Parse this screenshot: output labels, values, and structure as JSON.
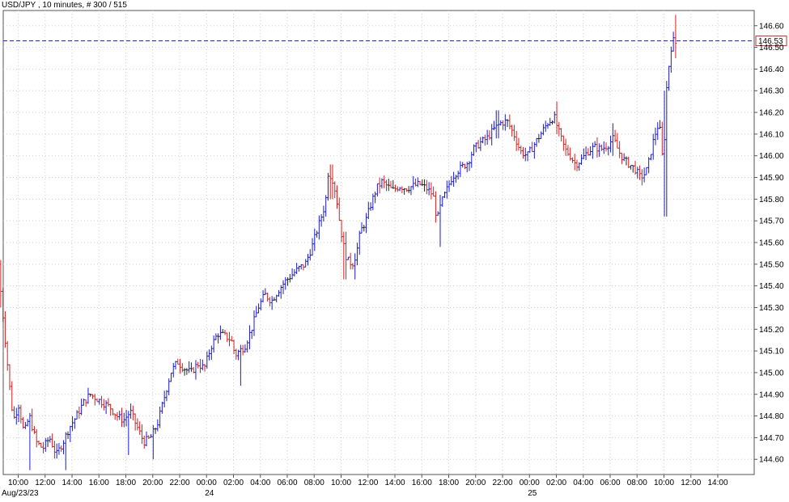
{
  "header": {
    "symbol": "USD/JPY",
    "timeframe": "10 minutes",
    "bar_count": "# 300 / 515"
  },
  "colors": {
    "up": "#1a1ad6",
    "down": "#d42020",
    "neutral": "#222222",
    "grid": "#cfcfcf",
    "current_price_line": "#2222cc"
  },
  "chart_data": {
    "type": "ohlc",
    "instrument": "USD/JPY",
    "interval": "10 minutes",
    "ylim": [
      144.53,
      146.67
    ],
    "y_ticks": [
      "146.60",
      "146.50",
      "146.40",
      "146.30",
      "146.20",
      "146.10",
      "146.00",
      "145.90",
      "145.80",
      "145.70",
      "145.60",
      "145.50",
      "145.40",
      "145.30",
      "145.20",
      "145.10",
      "145.00",
      "144.90",
      "144.80",
      "144.70",
      "144.60"
    ],
    "x_ticks": [
      {
        "label": "10:00",
        "hour": 10
      },
      {
        "label": "12:00",
        "hour": 12
      },
      {
        "label": "14:00",
        "hour": 14
      },
      {
        "label": "16:00",
        "hour": 16
      },
      {
        "label": "18:00",
        "hour": 18
      },
      {
        "label": "20:00",
        "hour": 20
      },
      {
        "label": "22:00",
        "hour": 22
      },
      {
        "label": "00:00",
        "hour": 24
      },
      {
        "label": "02:00",
        "hour": 26
      },
      {
        "label": "04:00",
        "hour": 28
      },
      {
        "label": "06:00",
        "hour": 30
      },
      {
        "label": "08:00",
        "hour": 32
      },
      {
        "label": "10:00",
        "hour": 34
      },
      {
        "label": "12:00",
        "hour": 36
      },
      {
        "label": "14:00",
        "hour": 38
      },
      {
        "label": "16:00",
        "hour": 40
      },
      {
        "label": "18:00",
        "hour": 42
      },
      {
        "label": "20:00",
        "hour": 44
      },
      {
        "label": "22:00",
        "hour": 46
      },
      {
        "label": "00:00",
        "hour": 48
      },
      {
        "label": "02:00",
        "hour": 50
      },
      {
        "label": "04:00",
        "hour": 52
      },
      {
        "label": "06:00",
        "hour": 54
      },
      {
        "label": "08:00",
        "hour": 56
      },
      {
        "label": "10:00",
        "hour": 58
      },
      {
        "label": "12:00",
        "hour": 60
      },
      {
        "label": "14:00",
        "hour": 62
      }
    ],
    "date_labels": [
      {
        "label": "Aug/23/23",
        "hour": 8.6
      },
      {
        "label": "24",
        "hour": 24
      },
      {
        "label": "25",
        "hour": 48
      }
    ],
    "current_price": 146.53,
    "current_price_label": "146.53",
    "price_path": [
      [
        8.7,
        145.5
      ],
      [
        8.9,
        145.35
      ],
      [
        9.2,
        145.15
      ],
      [
        9.5,
        144.95
      ],
      [
        9.8,
        144.78
      ],
      [
        10.2,
        144.85
      ],
      [
        10.6,
        144.72
      ],
      [
        11.0,
        144.8
      ],
      [
        11.5,
        144.68
      ],
      [
        12.0,
        144.65
      ],
      [
        12.5,
        144.7
      ],
      [
        13.0,
        144.62
      ],
      [
        13.5,
        144.68
      ],
      [
        14.0,
        144.75
      ],
      [
        14.5,
        144.8
      ],
      [
        15.0,
        144.86
      ],
      [
        15.5,
        144.9
      ],
      [
        16.0,
        144.88
      ],
      [
        16.5,
        144.86
      ],
      [
        17.0,
        144.84
      ],
      [
        17.5,
        144.8
      ],
      [
        18.0,
        144.78
      ],
      [
        18.5,
        144.82
      ],
      [
        19.0,
        144.75
      ],
      [
        19.5,
        144.68
      ],
      [
        20.0,
        144.7
      ],
      [
        20.5,
        144.76
      ],
      [
        21.0,
        144.88
      ],
      [
        21.5,
        145.0
      ],
      [
        22.0,
        145.05
      ],
      [
        22.5,
        145.02
      ],
      [
        23.0,
        145.0
      ],
      [
        23.5,
        145.04
      ],
      [
        24.0,
        145.02
      ],
      [
        24.5,
        145.12
      ],
      [
        25.0,
        145.18
      ],
      [
        25.5,
        145.17
      ],
      [
        26.0,
        145.15
      ],
      [
        26.3,
        145.08
      ],
      [
        26.6,
        145.1
      ],
      [
        27.0,
        145.12
      ],
      [
        27.5,
        145.2
      ],
      [
        28.0,
        145.3
      ],
      [
        28.5,
        145.36
      ],
      [
        29.0,
        145.33
      ],
      [
        29.5,
        145.38
      ],
      [
        30.0,
        145.42
      ],
      [
        30.5,
        145.45
      ],
      [
        31.0,
        145.48
      ],
      [
        31.5,
        145.5
      ],
      [
        32.0,
        145.58
      ],
      [
        32.5,
        145.68
      ],
      [
        33.0,
        145.78
      ],
      [
        33.2,
        145.92
      ],
      [
        33.5,
        145.9
      ],
      [
        33.8,
        145.82
      ],
      [
        34.0,
        145.72
      ],
      [
        34.3,
        145.6
      ],
      [
        34.6,
        145.52
      ],
      [
        35.0,
        145.5
      ],
      [
        35.3,
        145.55
      ],
      [
        35.6,
        145.65
      ],
      [
        36.0,
        145.7
      ],
      [
        36.4,
        145.78
      ],
      [
        36.8,
        145.85
      ],
      [
        37.2,
        145.88
      ],
      [
        37.6,
        145.86
      ],
      [
        38.0,
        145.84
      ],
      [
        38.5,
        145.86
      ],
      [
        39.0,
        145.85
      ],
      [
        39.5,
        145.86
      ],
      [
        40.0,
        145.87
      ],
      [
        40.5,
        145.85
      ],
      [
        41.0,
        145.82
      ],
      [
        41.3,
        145.7
      ],
      [
        41.6,
        145.78
      ],
      [
        42.0,
        145.84
      ],
      [
        42.4,
        145.9
      ],
      [
        42.8,
        145.93
      ],
      [
        43.2,
        145.95
      ],
      [
        43.6,
        145.97
      ],
      [
        44.0,
        146.03
      ],
      [
        44.5,
        146.06
      ],
      [
        45.0,
        146.08
      ],
      [
        45.5,
        146.12
      ],
      [
        46.0,
        146.15
      ],
      [
        46.5,
        146.16
      ],
      [
        47.0,
        146.1
      ],
      [
        47.5,
        146.02
      ],
      [
        48.0,
        146.0
      ],
      [
        48.5,
        146.05
      ],
      [
        49.0,
        146.1
      ],
      [
        49.5,
        146.15
      ],
      [
        50.0,
        146.18
      ],
      [
        50.4,
        146.1
      ],
      [
        50.8,
        146.03
      ],
      [
        51.2,
        146.0
      ],
      [
        51.6,
        145.96
      ],
      [
        52.0,
        145.98
      ],
      [
        52.5,
        146.02
      ],
      [
        53.0,
        146.04
      ],
      [
        53.5,
        146.03
      ],
      [
        54.0,
        146.05
      ],
      [
        54.4,
        146.08
      ],
      [
        54.8,
        146.02
      ],
      [
        55.2,
        145.98
      ],
      [
        55.6,
        145.96
      ],
      [
        56.0,
        145.94
      ],
      [
        56.4,
        145.9
      ],
      [
        56.8,
        145.92
      ],
      [
        57.0,
        145.96
      ],
      [
        57.3,
        146.05
      ],
      [
        57.6,
        146.12
      ],
      [
        57.8,
        146.15
      ],
      [
        58.0,
        146.05
      ],
      [
        58.1,
        145.9
      ],
      [
        58.25,
        146.18
      ],
      [
        58.4,
        146.35
      ],
      [
        58.6,
        146.45
      ],
      [
        58.8,
        146.55
      ],
      [
        58.9,
        146.52
      ]
    ],
    "extreme_wicks": [
      {
        "hour": 8.7,
        "high": 145.5,
        "low": 145.3
      },
      {
        "hour": 10.8,
        "high": 144.75,
        "low": 144.55
      },
      {
        "hour": 13.5,
        "high": 144.7,
        "low": 144.55
      },
      {
        "hour": 18.2,
        "high": 144.82,
        "low": 144.62
      },
      {
        "hour": 20.0,
        "high": 144.72,
        "low": 144.6
      },
      {
        "hour": 26.6,
        "high": 145.1,
        "low": 144.94
      },
      {
        "hour": 33.3,
        "high": 145.96,
        "low": 145.8
      },
      {
        "hour": 34.3,
        "high": 145.65,
        "low": 145.43
      },
      {
        "hour": 35.0,
        "high": 145.55,
        "low": 145.43
      },
      {
        "hour": 41.3,
        "high": 145.82,
        "low": 145.58
      },
      {
        "hour": 45.6,
        "high": 146.21,
        "low": 146.08
      },
      {
        "hour": 50.0,
        "high": 146.25,
        "low": 146.1
      },
      {
        "hour": 54.2,
        "high": 146.15,
        "low": 146.0
      },
      {
        "hour": 58.1,
        "high": 146.3,
        "low": 145.72
      },
      {
        "hour": 58.8,
        "high": 146.65,
        "low": 146.45
      }
    ]
  }
}
